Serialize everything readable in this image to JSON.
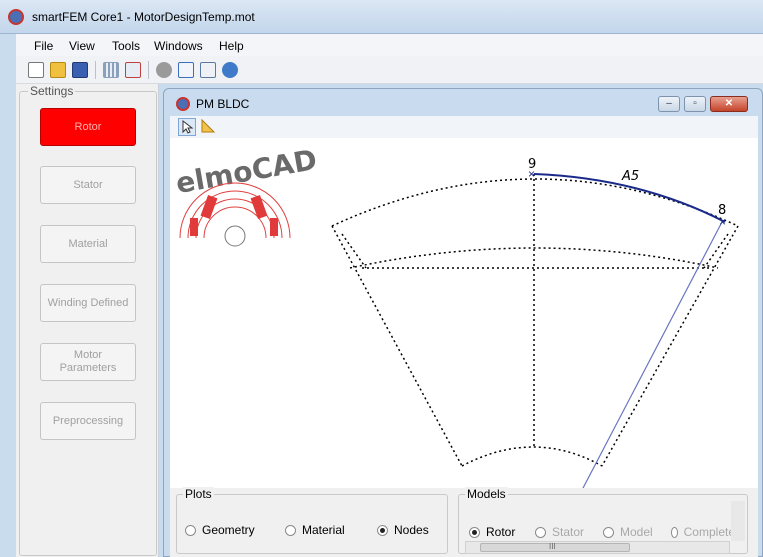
{
  "window": {
    "title": "smartFEM Core1  -  MotorDesignTemp.mot"
  },
  "menu": [
    "File",
    "View",
    "Tools",
    "Windows",
    "Help"
  ],
  "toolbar_icons": [
    "new-file-icon",
    "open-folder-icon",
    "save-icon",
    "grid-icon",
    "table-icon",
    "gear-icon",
    "edit-icon",
    "list-icon",
    "globe-icon"
  ],
  "settings": {
    "legend": "Settings",
    "buttons": [
      {
        "label": "Rotor",
        "active": true
      },
      {
        "label": "Stator",
        "active": false
      },
      {
        "label": "Material",
        "active": false
      },
      {
        "label": "Winding Defined",
        "active": false
      },
      {
        "label": "Motor\nParameters",
        "active": false
      },
      {
        "label": "Preprocessing",
        "active": false
      }
    ]
  },
  "child_window": {
    "title": "PM BLDC",
    "controls": {
      "minimize": "–",
      "restore": "▫",
      "close": "✕"
    },
    "tools": [
      "pointer-icon",
      "ruler-icon"
    ]
  },
  "canvas": {
    "logo": "elmoCAD",
    "labels": {
      "node_top": "9",
      "node_right": "8",
      "arc": "A5"
    }
  },
  "plots": {
    "legend": "Plots",
    "options": [
      {
        "label": "Geometry",
        "selected": false
      },
      {
        "label": "Material",
        "selected": false
      },
      {
        "label": "Nodes",
        "selected": true
      }
    ]
  },
  "models": {
    "legend": "Models",
    "options": [
      {
        "label": "Rotor",
        "selected": true,
        "enabled": true
      },
      {
        "label": "Stator",
        "selected": false,
        "enabled": false
      },
      {
        "label": "Model",
        "selected": false,
        "enabled": false
      },
      {
        "label": "Complete",
        "selected": false,
        "enabled": false
      }
    ],
    "scroll_grip": "III"
  }
}
